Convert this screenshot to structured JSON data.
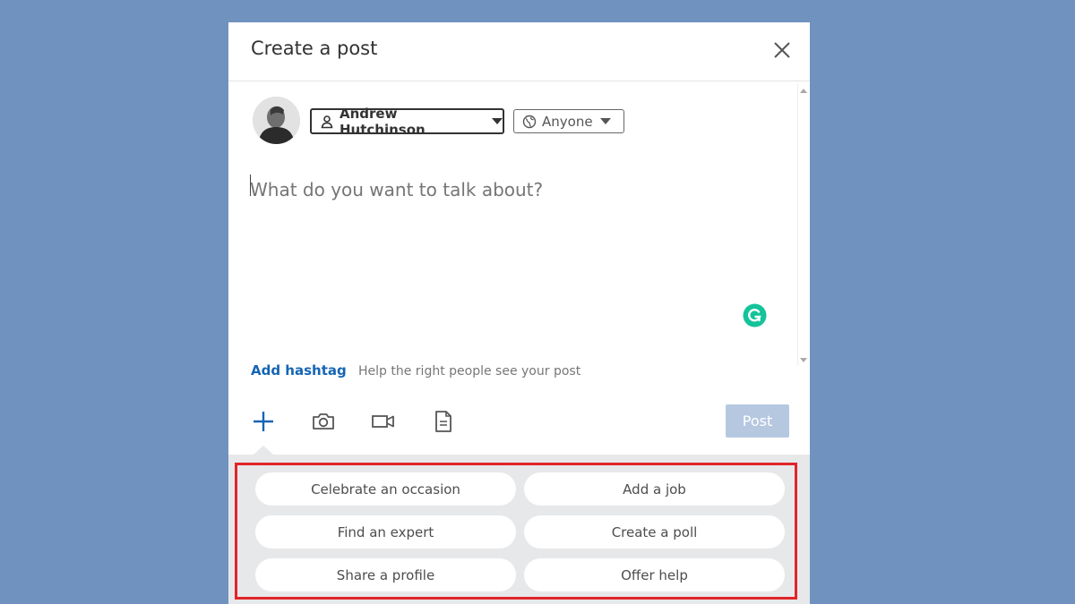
{
  "modal": {
    "title": "Create a post",
    "close_icon": "close-icon"
  },
  "author": {
    "name": "Andrew Hutchinson",
    "icon": "person-icon"
  },
  "visibility": {
    "label": "Anyone",
    "icon": "globe-icon"
  },
  "editor": {
    "placeholder": "What do you want to talk about?"
  },
  "hashtag": {
    "link_label": "Add hashtag",
    "help_text": "Help the right people see your post"
  },
  "toolbar": {
    "icons": [
      "plus-icon",
      "camera-icon",
      "video-icon",
      "document-icon"
    ],
    "post_label": "Post"
  },
  "suggestions": {
    "items": [
      {
        "label": "Celebrate an occasion"
      },
      {
        "label": "Add a job"
      },
      {
        "label": "Find an expert"
      },
      {
        "label": "Create a poll"
      },
      {
        "label": "Share a profile"
      },
      {
        "label": "Offer help"
      }
    ]
  },
  "colors": {
    "background": "#7092bf",
    "link": "#1565b4",
    "highlight": "#e0242a",
    "post_disabled": "#b6c8e0",
    "grammarly": "#15c39a"
  }
}
